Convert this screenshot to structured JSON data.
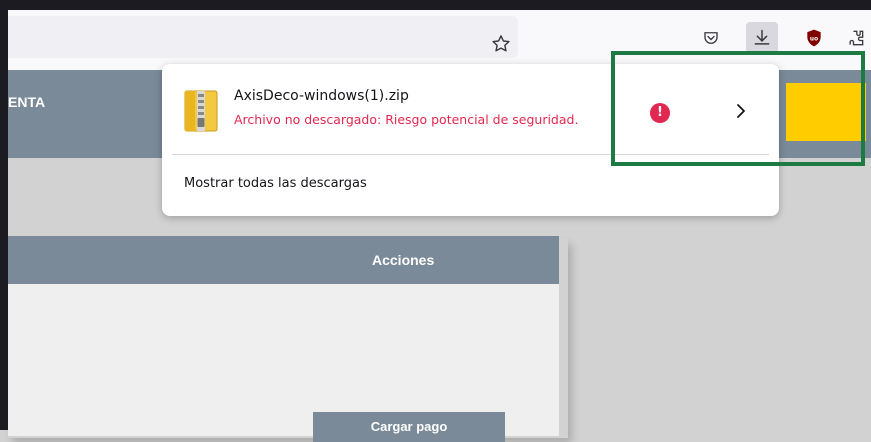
{
  "colors": {
    "toolbar_bg": "#f9f9fb",
    "urlbar_bg": "#f0f0f4",
    "page_header_bg": "#7a8a99",
    "accent_yellow": "#ffcc00",
    "warning_red": "#e22850",
    "highlight_green": "#1e7a43"
  },
  "toolbar": {
    "icons": [
      "star-icon",
      "pocket-icon",
      "download-icon",
      "ublock-icon",
      "extensions-icon"
    ]
  },
  "page": {
    "header_text": "ENTA",
    "panel_header_label": "Acciones",
    "cargar_button_label": "Cargar pago"
  },
  "downloads": {
    "item": {
      "filename": "AxisDeco-windows(1).zip",
      "status": "Archivo no descargado: Riesgo potencial de seguridad.",
      "warning_icon_text": "!"
    },
    "show_all_label": "Mostrar todas las descargas"
  }
}
